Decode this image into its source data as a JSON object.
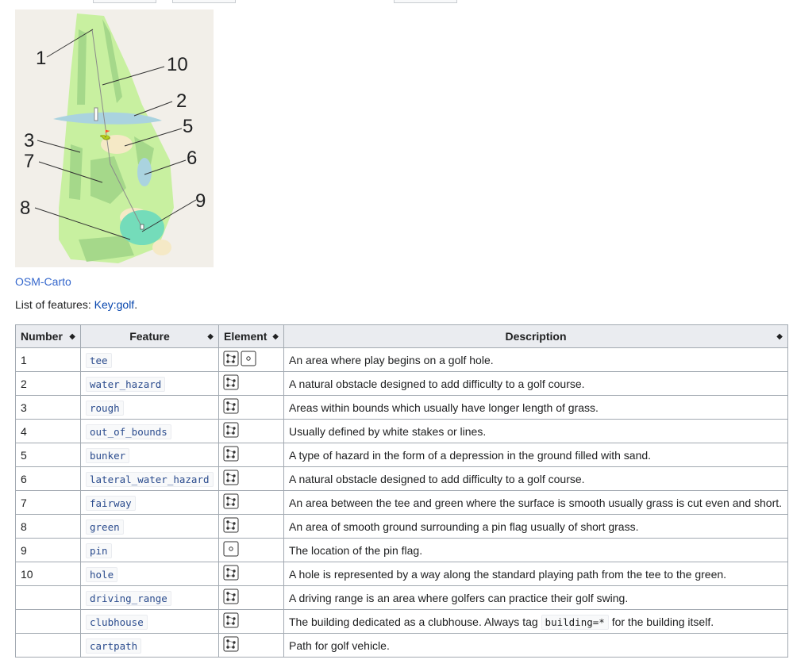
{
  "map": {
    "callouts": [
      "1",
      "10",
      "2",
      "5",
      "3",
      "7",
      "6",
      "8",
      "9"
    ],
    "caption": "OSM-Carto"
  },
  "features_line": {
    "prefix": "List of features: ",
    "link": "Key:golf",
    "suffix": "."
  },
  "table": {
    "headers": [
      "Number",
      "Feature",
      "Element",
      "Description"
    ],
    "rows": [
      {
        "number": "1",
        "feature": "tee",
        "elements": [
          "area",
          "node"
        ],
        "description": "An area where play begins on a golf hole."
      },
      {
        "number": "2",
        "feature": "water_hazard",
        "elements": [
          "area"
        ],
        "description": "A natural obstacle designed to add difficulty to a golf course."
      },
      {
        "number": "3",
        "feature": "rough",
        "elements": [
          "area"
        ],
        "description": "Areas within bounds which usually have longer length of grass."
      },
      {
        "number": "4",
        "feature": "out_of_bounds",
        "elements": [
          "area"
        ],
        "description": "Usually defined by white stakes or lines."
      },
      {
        "number": "5",
        "feature": "bunker",
        "elements": [
          "area"
        ],
        "description": "A type of hazard in the form of a depression in the ground filled with sand."
      },
      {
        "number": "6",
        "feature": "lateral_water_hazard",
        "elements": [
          "area"
        ],
        "description": "A natural obstacle designed to add difficulty to a golf course."
      },
      {
        "number": "7",
        "feature": "fairway",
        "elements": [
          "area"
        ],
        "description": "An area between the tee and green where the surface is smooth usually grass is cut even and short."
      },
      {
        "number": "8",
        "feature": "green",
        "elements": [
          "area"
        ],
        "description": "An area of smooth ground surrounding a pin flag usually of short grass."
      },
      {
        "number": "9",
        "feature": "pin",
        "elements": [
          "node"
        ],
        "description": "The location of the pin flag."
      },
      {
        "number": "10",
        "feature": "hole",
        "elements": [
          "area"
        ],
        "description": "A hole is represented by a way along the standard playing path from the tee to the green."
      },
      {
        "number": "",
        "feature": "driving_range",
        "elements": [
          "area"
        ],
        "description": "A driving range is an area where golfers can practice their golf swing."
      },
      {
        "number": "",
        "feature": "clubhouse",
        "elements": [
          "area"
        ],
        "description": "The building dedicated as a clubhouse. Always tag ",
        "code": "building=*",
        "description_after": " for the building itself."
      },
      {
        "number": "",
        "feature": "cartpath",
        "elements": [
          "area"
        ],
        "description": "Path for golf vehicle."
      }
    ]
  }
}
